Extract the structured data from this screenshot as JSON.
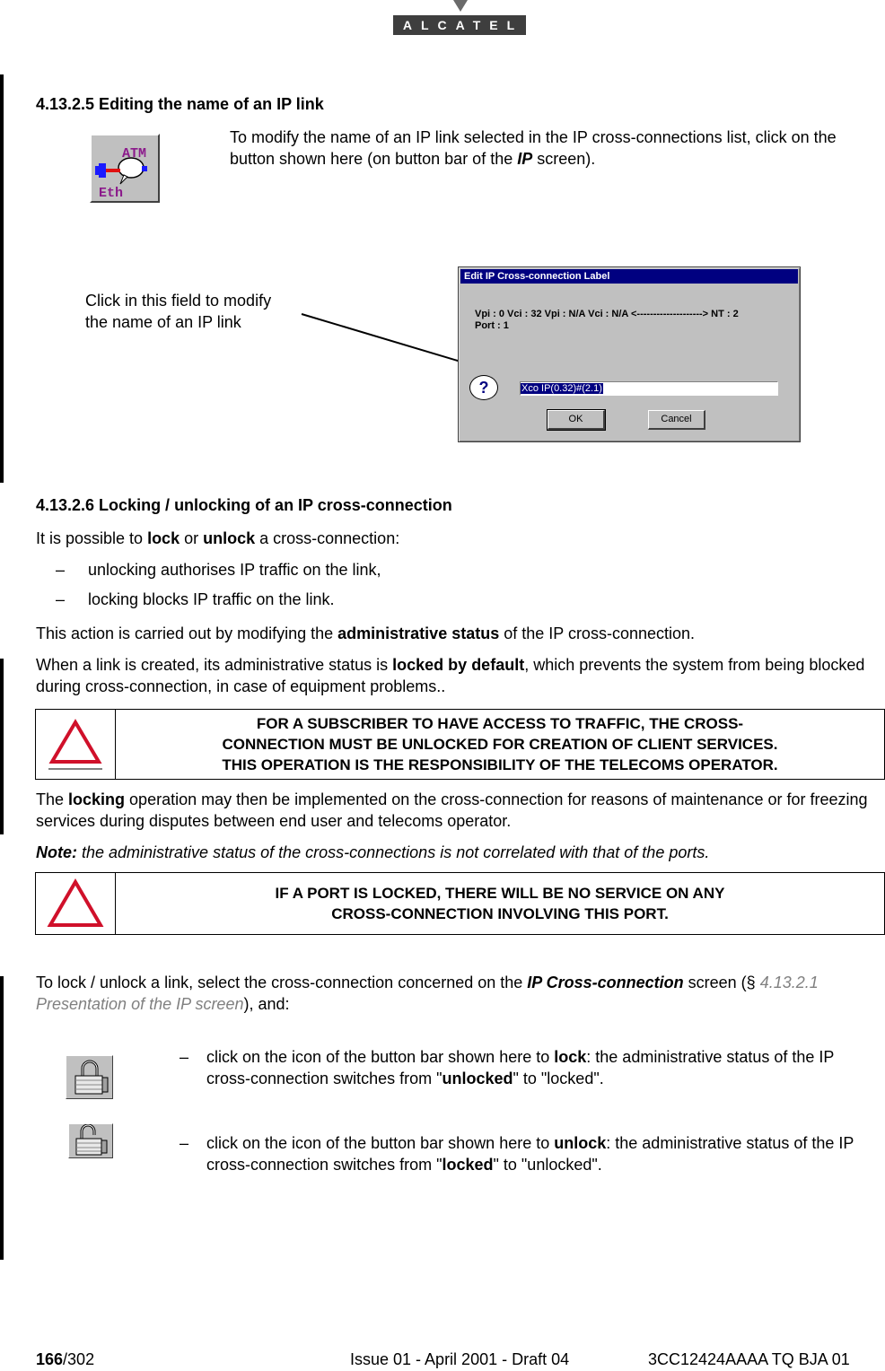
{
  "header": {
    "brand": "ALCATEL"
  },
  "section_4_13_2_5": {
    "heading": "4.13.2.5  Editing the name of an IP link",
    "intro_pre": "To modify the name of an IP link selected in the IP cross-connections list, click on the button shown here (on button bar of the ",
    "intro_bold_italic": "IP",
    "intro_post": " screen).",
    "toolbar_icon": {
      "name": "edit-label-atm-eth-icon",
      "text_top": "ATM",
      "text_bottom": "Eth"
    },
    "callout": {
      "line1": "Click in this field to modify",
      "line2": "the name of an IP link"
    },
    "dialog": {
      "title": "Edit IP Cross-connection Label",
      "info_line1": "Vpi : 0 Vci : 32 Vpi : N/A Vci : N/A <--------------------> NT : 2",
      "info_line2": "Port : 1",
      "help_icon": "?",
      "label_value": "Xco IP(0.32)#(2.1)",
      "ok_label": "OK",
      "cancel_label": "Cancel"
    }
  },
  "section_4_13_2_6": {
    "heading": "4.13.2.6  Locking / unlocking of an IP cross-connection",
    "p1_pre": "It is possible to ",
    "p1_b1": "lock",
    "p1_mid": " or ",
    "p1_b2": "unlock",
    "p1_post": " a cross-connection:",
    "bullets": [
      "unlocking authorises IP traffic on the link,",
      "locking blocks IP traffic on the link."
    ],
    "dash": "–",
    "p2_pre": "This action is carried out by modifying the ",
    "p2_bold": "administrative status",
    "p2_post": " of the IP cross-connection.",
    "p3_pre": "When a link is created, its administrative status is ",
    "p3_bold": "locked by default",
    "p3_post": ", which prevents the system from being blocked during cross-connection, in case of equipment problems..",
    "warning1": {
      "line1": "FOR A SUBSCRIBER TO HAVE ACCESS TO TRAFFIC, THE CROSS-",
      "line2": "CONNECTION MUST BE UNLOCKED FOR CREATION OF CLIENT SERVICES.",
      "line3": "THIS OPERATION IS THE RESPONSIBILITY OF THE TELECOMS OPERATOR."
    },
    "p4_pre": "The ",
    "p4_bold": "locking",
    "p4_post": " operation may then be implemented on the cross-connection for reasons of maintenance or for freezing services during disputes between end user and telecoms operator.",
    "note_label": "Note:",
    "note_text": " the administrative status of the cross-connections is not correlated with that of the ports.",
    "warning2": {
      "line1": "IF A PORT IS LOCKED, THERE WILL BE NO SERVICE ON ANY",
      "line2": "CROSS-CONNECTION INVOLVING THIS PORT."
    },
    "p5_pre": "To lock / unlock a link, select the cross-connection concerned on the ",
    "p5_bi": "IP Cross-connection",
    "p5_mid": " screen (§ ",
    "p5_xref": "4.13.2.1 Presentation of the IP screen",
    "p5_post": "), and:",
    "lock_item": {
      "pre": "click on the icon of the button bar shown here to ",
      "bold": "lock",
      "mid": ": the administrative status of the IP cross-connection switches from \"",
      "bold2": "unlocked",
      "post": "\" to \"locked\"."
    },
    "unlock_item": {
      "pre": "click on the icon of the button bar shown here to ",
      "bold": "unlock",
      "mid": ": the administrative status of the IP cross-connection switches from \"",
      "bold2": "locked",
      "post": "\" to \"unlocked\"."
    }
  },
  "footer": {
    "page_current": "166",
    "page_total": "/302",
    "issue": "Issue 01 - April 2001 - Draft 04",
    "doc_ref": "3CC12424AAAA TQ BJA 01"
  },
  "colors": {
    "warning_red": "#d0102a",
    "dialog_title_bg": "#000080",
    "xref_gray": "#808080"
  }
}
